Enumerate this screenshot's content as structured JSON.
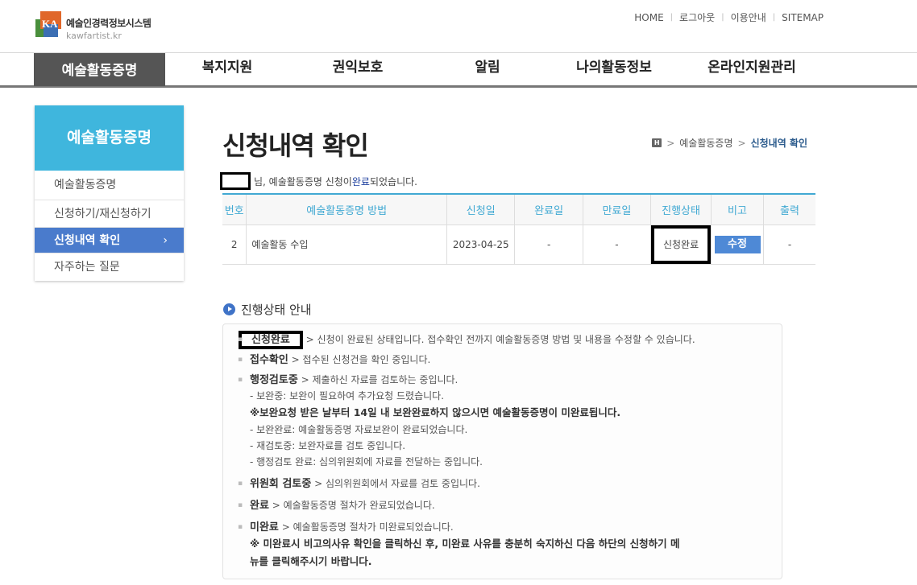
{
  "header": {
    "logo_mark": "KA",
    "logo_title": "예술인경력정보시스템",
    "logo_sub": "kawfartist.kr",
    "top_links": [
      "HOME",
      "로그아웃",
      "이용안내",
      "SITEMAP"
    ]
  },
  "gnb": {
    "items": [
      "예술활동증명",
      "복지지원",
      "권익보호",
      "알림",
      "나의활동정보",
      "온라인지원관리"
    ],
    "active": "예술활동증명"
  },
  "lnb": {
    "title": "예술활동증명",
    "items": [
      "예술활동증명",
      "신청하기/재신청하기",
      "신청내역 확인",
      "자주하는 질문"
    ],
    "active": "신청내역 확인",
    "active_chevron": "›"
  },
  "page": {
    "title": "신청내역 확인",
    "breadcrumb": [
      "예술활동증명",
      "신청내역 확인"
    ],
    "home_icon_label": "H"
  },
  "message": {
    "prefix": "님, 예술활동증명 신청이 ",
    "done": "완료",
    "suffix": "되었습니다."
  },
  "table": {
    "headers": [
      "번호",
      "예술활동증명 방법",
      "신청일",
      "완료일",
      "만료일",
      "진행상태",
      "비고",
      "출력"
    ],
    "rows": [
      {
        "no": "2",
        "method": "예술활동 수입",
        "applied": "2023-04-25",
        "completed": "-",
        "expires": "-",
        "status": "신청완료",
        "note_button": "수정",
        "print": "-"
      }
    ]
  },
  "guide": {
    "title": "진행상태 안내",
    "items": [
      {
        "label": "신청완료",
        "text": " > 신청이 완료된 상태입니다. 접수확인 전까지 예술활동증명 방법 및 내용을 수정할 수 있습니다."
      },
      {
        "label": "접수확인",
        "text": " > 접수된 신청건을 확인 중입니다."
      },
      {
        "label": "행정검토중",
        "text": " > 제출하신 자료를 검토하는 중입니다."
      },
      {
        "label": "위원회 검토중",
        "text": " > 심의위원회에서 자료를 검토 중입니다."
      },
      {
        "label": "완료",
        "text": " > 예술활동증명 절차가 완료되었습니다."
      },
      {
        "label": "미완료",
        "text": " > 예술활동증명 절차가 미완료되었습니다."
      }
    ],
    "review_sub": [
      "- 보완중: 보완이 필요하여 추가요청 드렸습니다.",
      "※보완요청 받은 날부터 14일 내 보완완료하지 않으시면 예술활동증명이 미완료됩니다.",
      "- 보완완료: 예술활동증명 자료보완이 완료되었습니다.",
      "- 재검토중: 보완자료를 검토 중입니다.",
      "- 행정검토 완료: 심의위원회에 자료를 전달하는 중입니다."
    ],
    "incomplete_note_1": "※ 미완료시 비고의사유 확인을 클릭하신 후, 미완료 사유를 충분히 숙지하신 다음 하단의 신청하기 메",
    "incomplete_note_2": "뉴를 클릭해주시기 바랍니다."
  }
}
